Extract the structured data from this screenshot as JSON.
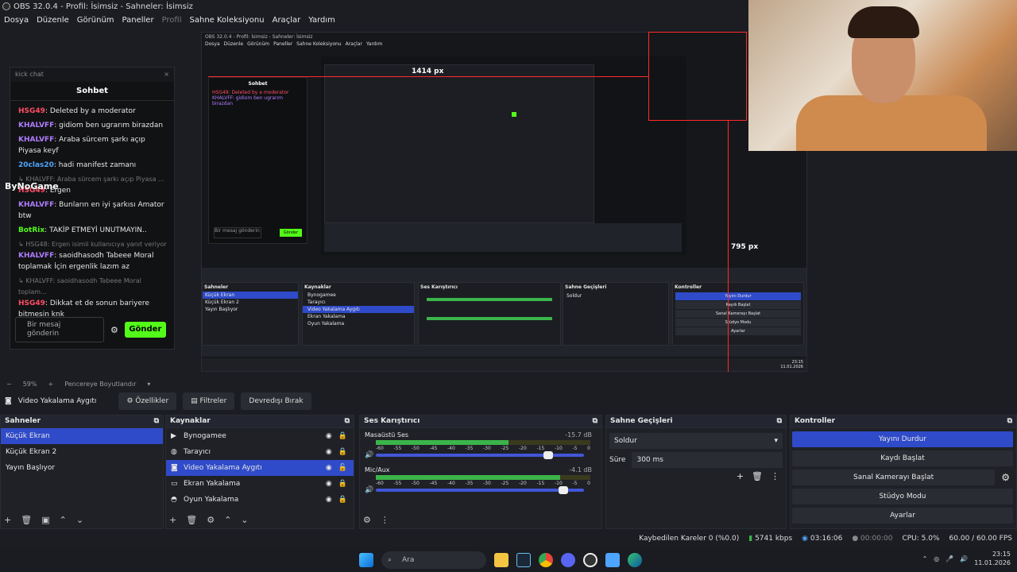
{
  "window": {
    "title": "OBS 32.0.4 - Profil: İsimsiz - Sahneler: İsimsiz"
  },
  "menu": {
    "items": [
      "Dosya",
      "Düzenle",
      "Görünüm",
      "Paneller",
      "Profil",
      "Sahne Koleksiyonu",
      "Araçlar",
      "Yardım"
    ]
  },
  "chat": {
    "header_small": "kick chat",
    "title": "Sohbet",
    "messages": [
      {
        "user": "HSG49",
        "text": ": Deleted by a moderator",
        "color": "red"
      },
      {
        "user": "KHALVFF",
        "text": ": gidiom ben ugrarım birazdan",
        "color": "purple"
      },
      {
        "user": "KHALVFF",
        "text": ": Araba sürcem şarkı açıp Piyasa keyf",
        "color": "purple"
      },
      {
        "user": "20clas20",
        "text": ": hadi manifest zamanı",
        "color": "blue"
      },
      {
        "reply": "↳ KHALVFF: Araba sürcem şarkı açıp Piyasa ...",
        "user": "HSG49",
        "text": ": Ergen",
        "color": "red"
      },
      {
        "user": "KHALVFF",
        "text": ": Bunların en iyi şarkısı Amator btw",
        "color": "purple"
      },
      {
        "user": "BotRix",
        "text": ": TAKİP ETMEYİ UNUTMAYIN..",
        "color": "green"
      },
      {
        "reply": "↳ HSG48: Ergen isimli kullanıcıya yanıt veriyor",
        "user": "KHALVFF",
        "text": ": saoidhasodh Tabeee Moral toplamak İçin ergenlik lazım az",
        "color": "purple"
      },
      {
        "reply": "↳ KHALVFF: saoidhasodh Tabeee Moral toplam...",
        "user": "HSG49",
        "text": ": Dikkat et de sonun bariyere bitmesin knk",
        "color": "red"
      }
    ],
    "input_placeholder": "Bir mesaj gönderin",
    "send_label": "Gönder"
  },
  "overlay": {
    "logo": "ByNoGame",
    "px_label_1": "1414 px",
    "px_label_2": "795 px"
  },
  "source_bar": {
    "zoom": "59%",
    "resize_label": "Pencereye Boyutlandır",
    "source_name": "Video Yakalama Aygıtı",
    "properties": "Özellikler",
    "filters": "Filtreler",
    "deactivate": "Devredışı Bırak"
  },
  "scenes": {
    "title": "Sahneler",
    "items": [
      "Küçük Ekran",
      "Küçük Ekran 2",
      "Yayın Başlıyor"
    ],
    "selected": 0
  },
  "sources": {
    "title": "Kaynaklar",
    "items": [
      "Bynogamee",
      "Tarayıcı",
      "Video Yakalama Aygıtı",
      "Ekran Yakalama",
      "Oyun Yakalama"
    ],
    "selected": 2
  },
  "mixer": {
    "title": "Ses Karıştırıcı",
    "channels": [
      {
        "name": "Masaüstü Ses",
        "db": "-15.7 dB",
        "level": 0.62,
        "volume": 0.83
      },
      {
        "name": "Mic/Aux",
        "db": "-4.1 dB",
        "level": 0.86,
        "volume": 0.9
      }
    ],
    "ticks": [
      "-60",
      "-55",
      "-50",
      "-45",
      "-40",
      "-35",
      "-30",
      "-25",
      "-20",
      "-15",
      "-10",
      "-5",
      "0"
    ]
  },
  "transitions": {
    "title": "Sahne Geçişleri",
    "type": "Soldur",
    "duration_label": "Süre",
    "duration": "300 ms"
  },
  "controls": {
    "title": "Kontroller",
    "buttons": [
      "Yayını Durdur",
      "Kaydı Başlat",
      "Sanal Kamerayı Başlat",
      "Stüdyo Modu",
      "Ayarlar"
    ]
  },
  "status": {
    "dropped": "Kaybedilen Kareler 0 (%0.0)",
    "bitrate": "5741 kbps",
    "stream_time": "03:16:06",
    "rec_time": "00:00:00",
    "cpu": "CPU: 5.0%",
    "fps": "60.00 / 60.00 FPS"
  },
  "taskbar": {
    "search": "Ara",
    "time": "23:15",
    "date": "11.01.2026"
  },
  "colors": {
    "accent": "#2f4bc9",
    "kick_green": "#53fc18",
    "meter_green": "#3bb54a",
    "meter_yellow": "#a99a2a"
  }
}
